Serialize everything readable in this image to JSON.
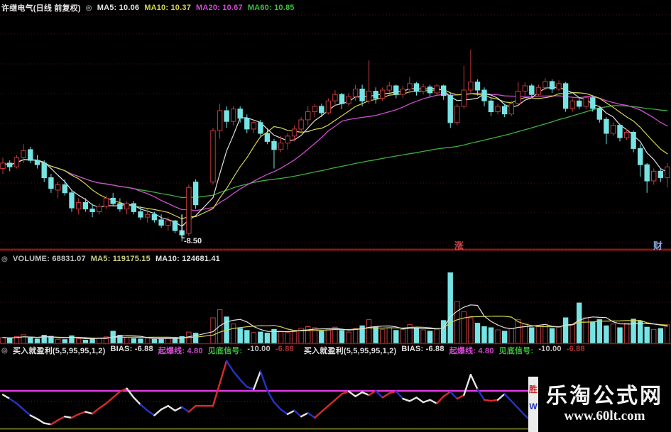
{
  "window": {
    "title": "许继电气(日线 前复权)"
  },
  "main_header": {
    "icon": "◎",
    "ma5": "MA5: 10.06",
    "ma10": "MA10: 10.37",
    "ma20": "MA20: 10.67",
    "ma60": "MA60: 10.85"
  },
  "volume_header": {
    "icon": "◎",
    "volume": "VOLUME: 68831.07",
    "ma5": "MA5: 119175.15",
    "ma10": "MA10: 124681.41"
  },
  "indicator_header": {
    "icon": "◎",
    "groups": [
      {
        "name": "买入就盈利(5,5,95,95,1,2)",
        "bias": "BIAS: -6.88",
        "trigger": "起爆线: 4.80",
        "bottom_label": "见底信号:",
        "bottom_value": "-10.00",
        "current": "-6.88"
      },
      {
        "name": "买入就盈利(5,5,95,95,1,2)",
        "bias": "BIAS: -6.88",
        "trigger": "起爆线: 4.80",
        "bottom_label": "见底信号:",
        "bottom_value": "-10.00",
        "current": "-6.88"
      }
    ]
  },
  "annotation": {
    "low_label": "-8.50"
  },
  "marks": {
    "rise": "涨",
    "wealth": "财"
  },
  "watermark": {
    "badge_top": "胜",
    "badge_bottom": "W",
    "title": "乐淘公式网",
    "url": "www.60lt.com"
  },
  "colors": {
    "background": "#000000",
    "candle_up": "#c23b3b",
    "candle_down": "#76e4e4",
    "ma5": "#e0e0e0",
    "ma10": "#d6d64e",
    "ma20": "#cf4ecf",
    "ma60": "#3faf3f",
    "vol_ma5": "#e0e0e0",
    "vol_ma10": "#d6d64e",
    "threshold": "#e23ae2",
    "bias_white": "#e6e6e6",
    "bias_red": "#d92b2b",
    "bias_blue": "#2633cc",
    "grid": "#4a1212",
    "divider": "#7d1414",
    "baseline": "#8b1a1a",
    "bottom_border": "#6d6d28"
  },
  "chart_data": [
    {
      "type": "candlestick",
      "title": "许继电气(日线 前复权)",
      "ylim": [
        8.4,
        12.6
      ],
      "gap_after_index": 28,
      "ma_periods": [
        5,
        10,
        20,
        60
      ],
      "annotation": {
        "index": 26,
        "price": 8.5,
        "label": "-8.50"
      },
      "candles": [
        [
          9.85,
          10.05,
          9.75,
          9.95
        ],
        [
          9.95,
          10.0,
          9.8,
          9.88
        ],
        [
          9.88,
          10.1,
          9.85,
          10.05
        ],
        [
          10.05,
          10.3,
          9.95,
          10.18
        ],
        [
          10.2,
          10.25,
          9.95,
          10.0
        ],
        [
          10.0,
          10.1,
          9.85,
          9.92
        ],
        [
          9.95,
          10.0,
          9.6,
          9.68
        ],
        [
          9.68,
          9.75,
          9.4,
          9.48
        ],
        [
          9.45,
          9.6,
          9.3,
          9.55
        ],
        [
          9.55,
          9.65,
          9.35,
          9.4
        ],
        [
          9.4,
          9.45,
          9.05,
          9.12
        ],
        [
          9.1,
          9.3,
          9.0,
          9.22
        ],
        [
          9.22,
          9.3,
          9.05,
          9.1
        ],
        [
          9.1,
          9.2,
          8.95,
          9.05
        ],
        [
          9.05,
          9.2,
          9.0,
          9.15
        ],
        [
          9.15,
          9.35,
          9.1,
          9.3
        ],
        [
          9.3,
          9.4,
          9.15,
          9.2
        ],
        [
          9.2,
          9.3,
          9.05,
          9.1
        ],
        [
          9.1,
          9.25,
          9.0,
          9.2
        ],
        [
          9.2,
          9.25,
          9.0,
          9.05
        ],
        [
          9.05,
          9.15,
          8.9,
          8.95
        ],
        [
          8.95,
          9.1,
          8.85,
          9.0
        ],
        [
          9.0,
          9.05,
          8.85,
          8.9
        ],
        [
          8.9,
          9.0,
          8.75,
          8.8
        ],
        [
          8.8,
          8.95,
          8.7,
          8.88
        ],
        [
          8.88,
          8.9,
          8.65,
          8.7
        ],
        [
          8.7,
          8.75,
          8.5,
          8.62
        ],
        [
          8.65,
          9.55,
          8.6,
          9.5
        ],
        [
          9.6,
          9.65,
          9.1,
          9.18
        ],
        [
          9.6,
          10.6,
          9.55,
          10.55
        ],
        [
          10.55,
          11.05,
          10.4,
          10.92
        ],
        [
          10.92,
          11.0,
          10.6,
          10.72
        ],
        [
          10.72,
          11.0,
          10.65,
          10.95
        ],
        [
          10.95,
          11.0,
          10.7,
          10.78
        ],
        [
          10.78,
          10.85,
          10.5,
          10.58
        ],
        [
          10.58,
          10.75,
          10.5,
          10.7
        ],
        [
          10.7,
          10.75,
          10.45,
          10.5
        ],
        [
          10.5,
          10.6,
          10.3,
          10.35
        ],
        [
          10.35,
          10.4,
          9.85,
          10.2
        ],
        [
          10.2,
          10.45,
          10.15,
          10.32
        ],
        [
          10.32,
          10.5,
          10.2,
          10.45
        ],
        [
          10.45,
          10.65,
          10.35,
          10.58
        ],
        [
          10.58,
          10.8,
          10.5,
          10.75
        ],
        [
          10.75,
          11.0,
          10.65,
          10.9
        ],
        [
          10.9,
          11.05,
          10.8,
          11.0
        ],
        [
          11.0,
          11.05,
          10.8,
          10.88
        ],
        [
          10.88,
          11.15,
          10.85,
          11.1
        ],
        [
          11.1,
          11.3,
          11.0,
          11.22
        ],
        [
          11.22,
          11.25,
          10.95,
          11.05
        ],
        [
          11.05,
          11.25,
          11.0,
          11.18
        ],
        [
          11.18,
          11.4,
          11.1,
          11.32
        ],
        [
          11.32,
          11.4,
          11.0,
          11.1
        ],
        [
          11.1,
          11.85,
          11.05,
          11.28
        ],
        [
          11.28,
          11.35,
          11.05,
          11.15
        ],
        [
          11.15,
          11.35,
          11.1,
          11.3
        ],
        [
          11.3,
          11.45,
          11.25,
          11.38
        ],
        [
          11.38,
          11.4,
          11.15,
          11.22
        ],
        [
          11.22,
          11.38,
          11.15,
          11.32
        ],
        [
          11.32,
          11.55,
          11.25,
          11.42
        ],
        [
          11.42,
          11.45,
          11.2,
          11.28
        ],
        [
          11.28,
          11.42,
          11.22,
          11.36
        ],
        [
          11.36,
          11.4,
          11.18,
          11.25
        ],
        [
          11.25,
          11.42,
          11.2,
          11.38
        ],
        [
          11.38,
          11.4,
          11.12,
          11.2
        ],
        [
          11.2,
          11.25,
          10.6,
          10.7
        ],
        [
          10.7,
          11.05,
          10.65,
          11.0
        ],
        [
          11.0,
          11.75,
          10.95,
          11.3
        ],
        [
          11.3,
          12.05,
          11.25,
          11.45
        ],
        [
          11.45,
          11.5,
          11.2,
          11.3
        ],
        [
          11.3,
          11.35,
          11.0,
          11.1
        ],
        [
          11.1,
          11.15,
          10.82,
          10.9
        ],
        [
          10.9,
          11.05,
          10.85,
          11.0
        ],
        [
          11.0,
          11.05,
          10.8,
          10.86
        ],
        [
          10.86,
          11.1,
          10.82,
          11.05
        ],
        [
          11.05,
          11.45,
          11.0,
          11.28
        ],
        [
          11.28,
          11.45,
          11.2,
          11.38
        ],
        [
          11.38,
          11.42,
          11.15,
          11.22
        ],
        [
          11.22,
          11.4,
          11.18,
          11.35
        ],
        [
          11.35,
          11.52,
          11.3,
          11.46
        ],
        [
          11.46,
          11.5,
          11.25,
          11.32
        ],
        [
          11.32,
          11.48,
          11.28,
          11.42
        ],
        [
          11.42,
          11.45,
          10.9,
          10.96
        ],
        [
          10.96,
          11.15,
          10.9,
          11.1
        ],
        [
          11.1,
          11.15,
          10.95,
          11.0
        ],
        [
          11.0,
          11.2,
          10.95,
          11.16
        ],
        [
          11.16,
          11.2,
          10.9,
          10.96
        ],
        [
          10.96,
          11.0,
          10.7,
          10.76
        ],
        [
          10.76,
          10.8,
          10.3,
          10.5
        ],
        [
          10.5,
          10.7,
          10.45,
          10.65
        ],
        [
          10.65,
          10.68,
          10.35,
          10.42
        ],
        [
          10.42,
          10.58,
          10.38,
          10.52
        ],
        [
          10.52,
          10.55,
          10.15,
          10.22
        ],
        [
          10.22,
          10.3,
          9.7,
          9.92
        ],
        [
          9.92,
          9.95,
          9.4,
          9.62
        ],
        [
          9.62,
          9.85,
          9.55,
          9.8
        ],
        [
          9.8,
          9.85,
          9.6,
          9.68
        ],
        [
          9.68,
          9.95,
          9.5,
          9.88
        ]
      ]
    },
    {
      "type": "bar",
      "title": "VOLUME",
      "ylim": [
        0,
        290000
      ],
      "ma_periods": [
        5,
        10
      ],
      "values": [
        22000,
        18000,
        25000,
        32000,
        20000,
        16000,
        30000,
        26000,
        15000,
        14000,
        28000,
        18000,
        12000,
        16000,
        20000,
        24000,
        45000,
        30000,
        22000,
        18000,
        16000,
        20000,
        15000,
        18000,
        22000,
        16000,
        25000,
        42000,
        38000,
        95000,
        125000,
        98000,
        72000,
        55000,
        48000,
        40000,
        42000,
        38000,
        52000,
        45000,
        40000,
        48000,
        56000,
        62000,
        58000,
        45000,
        52000,
        60000,
        48000,
        42000,
        55000,
        65000,
        88000,
        60000,
        52000,
        58000,
        48000,
        52000,
        70000,
        55000,
        50000,
        45000,
        52000,
        85000,
        262000,
        155000,
        118000,
        95000,
        75000,
        62000,
        58000,
        50000,
        45000,
        55000,
        88000,
        72000,
        58000,
        62000,
        70000,
        55000,
        60000,
        95000,
        70000,
        150000,
        95000,
        80000,
        88000,
        65000,
        72000,
        58000,
        75000,
        90000,
        82000,
        60000,
        52000,
        55000,
        68831
      ]
    },
    {
      "type": "line",
      "title": "买入就盈利(5,5,95,95,1,2) BIAS",
      "ylim": [
        -11,
        20
      ],
      "threshold": 4.8,
      "points": [
        [
          3.2,
          "w"
        ],
        [
          1.5,
          "w"
        ],
        [
          -0.5,
          "b"
        ],
        [
          -3,
          "b"
        ],
        [
          -5.5,
          "b"
        ],
        [
          -7,
          "w"
        ],
        [
          -8.8,
          "w"
        ],
        [
          -9.3,
          "w"
        ],
        [
          -7.5,
          "r"
        ],
        [
          -6,
          "r"
        ],
        [
          -6.5,
          "w"
        ],
        [
          -5,
          "r"
        ],
        [
          -4,
          "r"
        ],
        [
          -4.8,
          "w"
        ],
        [
          -2.5,
          "r"
        ],
        [
          -0.5,
          "r"
        ],
        [
          2,
          "r"
        ],
        [
          4.5,
          "r"
        ],
        [
          5.8,
          "r"
        ],
        [
          2,
          "w"
        ],
        [
          -1,
          "w"
        ],
        [
          -3.5,
          "b"
        ],
        [
          -5.5,
          "b"
        ],
        [
          -3,
          "w"
        ],
        [
          -1.5,
          "w"
        ],
        [
          -3.5,
          "w"
        ],
        [
          -2,
          "w"
        ],
        [
          -4,
          "b"
        ],
        [
          -1.5,
          "r"
        ],
        [
          -1.5,
          "r"
        ],
        [
          8,
          "r"
        ],
        [
          17.4,
          "r"
        ],
        [
          13,
          "b"
        ],
        [
          9.5,
          "b"
        ],
        [
          6.5,
          "b"
        ],
        [
          5.5,
          "b"
        ],
        [
          13,
          "w"
        ],
        [
          5,
          "b"
        ],
        [
          0,
          "b"
        ],
        [
          -3,
          "b"
        ],
        [
          -5,
          "b"
        ],
        [
          -3.5,
          "w"
        ],
        [
          -6,
          "b"
        ],
        [
          -4.5,
          "w"
        ],
        [
          -6.5,
          "b"
        ],
        [
          -4,
          "r"
        ],
        [
          -1.5,
          "r"
        ],
        [
          1,
          "r"
        ],
        [
          3.5,
          "r"
        ],
        [
          4.6,
          "r"
        ],
        [
          2.5,
          "w"
        ],
        [
          4.2,
          "w"
        ],
        [
          3,
          "w"
        ],
        [
          4.8,
          "r"
        ],
        [
          2,
          "b"
        ],
        [
          3.8,
          "r"
        ],
        [
          4.6,
          "r"
        ],
        [
          1.5,
          "b"
        ],
        [
          0.5,
          "w"
        ],
        [
          2,
          "w"
        ],
        [
          0,
          "w"
        ],
        [
          1,
          "w"
        ],
        [
          -0.5,
          "w"
        ],
        [
          2.5,
          "r"
        ],
        [
          4.4,
          "r"
        ],
        [
          1.5,
          "b"
        ],
        [
          3,
          "r"
        ],
        [
          11.6,
          "w"
        ],
        [
          5.5,
          "w"
        ],
        [
          1,
          "b"
        ],
        [
          0.6,
          "r"
        ],
        [
          1,
          "r"
        ],
        [
          3.5,
          "w"
        ],
        [
          0.5,
          "b"
        ],
        [
          -2.5,
          "b"
        ],
        [
          -5.5,
          "b"
        ],
        [
          -8,
          "b"
        ],
        [
          -9.3,
          "b"
        ],
        [
          -9.8,
          "b"
        ],
        [
          -9.5,
          "b"
        ],
        [
          -9,
          "b"
        ],
        [
          -8.5,
          "b"
        ],
        [
          -8.2,
          "b"
        ],
        [
          -8,
          "b"
        ],
        [
          -7.8,
          "b"
        ],
        [
          -7.6,
          "b"
        ],
        [
          -7.4,
          "b"
        ],
        [
          -7.2,
          "b"
        ],
        [
          -7,
          "b"
        ],
        [
          -6.9,
          "b"
        ],
        [
          -6.88,
          "b"
        ],
        [
          -6.9,
          "b"
        ],
        [
          -6.88,
          "b"
        ],
        [
          -6.9,
          "b"
        ],
        [
          -6.88,
          "b"
        ],
        [
          -6.9,
          "b"
        ],
        [
          -6.88,
          "b"
        ]
      ]
    }
  ]
}
